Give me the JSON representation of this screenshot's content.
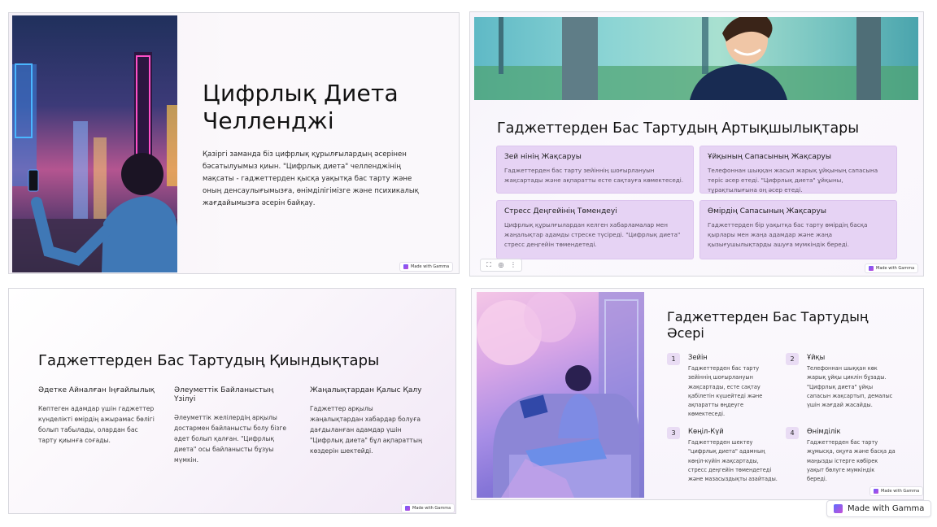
{
  "badge_label": "Made with Gamma",
  "colors": {
    "card_bg": "#e6d3f4",
    "accent": "#8a4fd6",
    "text": "#111111"
  },
  "slide1": {
    "title_line1": "Цифрлық Диета",
    "title_line2": "Челленджі",
    "body": "Қазіргі заманда біз цифрлық құрылғылардың әсерінен бәсатылуымыз қиын. \"Цифрлық диета\" челленджінің мақсаты - гаджеттерден қысқа уақытқа бас тарту және оның денсаулығымызға, өнімділігімізге және психикалық жағдайымызға әсерін байқау."
  },
  "slide2": {
    "title": "Гаджеттерден Бас Тартудың Артықшылықтары",
    "cards": [
      {
        "title": "Зей нінің Жақсаруы",
        "body": "Гаджеттерден бас тарту зейіннің шоғырлануын жақсартады және ақпаратты есте сақтауға көмектеседі."
      },
      {
        "title": "Ұйқының Сапасының Жақсаруы",
        "body": "Телефоннан шыққан жасыл жарық ұйқының сапасына теріс әсер етеді. \"Цифрлық диета\" ұйқыны, тұрақтылығына оң әсер етеді."
      },
      {
        "title": "Стресс Деңгейінің Төмендеуі",
        "body": "Цифрлық құрылғылардан келген хабарламалар мен жаңалықтар адамды стреске түсіреді. \"Цифрлық диета\" стресс деңгейін төмендетеді."
      },
      {
        "title": "Өмірдің Сапасының Жақсаруы",
        "body": "Гаджеттерден бір уақытқа бас тарту өмірдің басқа қырлары мен жаңа адамдар және жаңа қызығушылықтарды ашуға мүмкіндік береді."
      }
    ],
    "toolbar": [
      "⛶",
      "◎",
      "⋮"
    ]
  },
  "slide3": {
    "title": "Гаджеттерден Бас Тартудың Қиындықтары",
    "columns": [
      {
        "title": "Әдетке Айналған Іңғайлылық",
        "body": "Көптеген адамдар үшін гаджеттер күнделікті өмірдің ажырамас бөлігі болып табылады, олардан бас тарту қиынға соғады."
      },
      {
        "title": "Әлеуметтік Байланыстың Үзілуі",
        "body": "Әлеуметтік желілердің арқылы достармен байланысты болу бізге әдет болып қалған. \"Цифрлық диета\" осы байланысты бұзуы мүмкін."
      },
      {
        "title": "Жаңалықтардан Қалыс Қалу",
        "body": "Гаджеттер арқылы жаңалықтардан хабардар болуға дағдыланған адамдар үшін \"Цифрлық диета\" бұл ақпараттың көздерін шектейді."
      }
    ]
  },
  "slide4": {
    "title_line1": "Гаджеттерден Бас Тартудың",
    "title_line2": "Әсері",
    "items": [
      {
        "num": "1",
        "title": "Зейін",
        "body": "Гаджеттерден бас тарту зейіннің шоғырлануын жақсартады, есте сақтау қабілетін күшейтеді және ақпаратты өңдеуге көмектеседі."
      },
      {
        "num": "2",
        "title": "Ұйқы",
        "body": "Телефоннан шыққан көк жарық ұйқы циклін бұзады. \"Цифрлық диета\" ұйқы сапасын жақсартып, демалыс үшін жағдай жасайды."
      },
      {
        "num": "3",
        "title": "Көңіл-Күй",
        "body": "Гаджеттерден шектеу \"цифрлық диета\" адамның көңіл-күйін жақсартады, стресс деңгейін төмендетеді және мазасыздықты азайтады."
      },
      {
        "num": "4",
        "title": "Өнімділік",
        "body": "Гаджеттерден бас тарту жұмысқа, оқуға және басқа да маңызды істерге көбірек уақыт бөлуге мүмкіндік береді."
      }
    ]
  }
}
